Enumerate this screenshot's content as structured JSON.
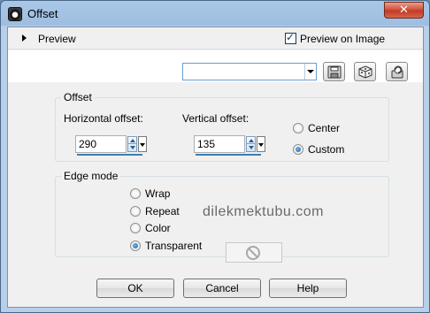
{
  "window": {
    "title": "Offset",
    "close_glyph": "✕"
  },
  "preview": {
    "label": "Preview",
    "preview_on_image_label": "Preview on Image",
    "preview_on_image_checked": true
  },
  "presets": {
    "value": ""
  },
  "toolbar": {
    "icons": [
      "save-preset-icon",
      "randomize-dice-icon",
      "reset-icon"
    ]
  },
  "offset": {
    "group_title": "Offset",
    "horizontal_label": "Horizontal offset:",
    "horizontal_value": "290",
    "vertical_label": "Vertical offset:",
    "vertical_value": "135",
    "center_label": "Center",
    "custom_label": "Custom",
    "selected": "Custom"
  },
  "edge": {
    "group_title": "Edge mode",
    "options": [
      "Wrap",
      "Repeat",
      "Color",
      "Transparent"
    ],
    "selected": "Transparent"
  },
  "watermark": "dilekmektubu.com",
  "buttons": {
    "ok": "OK",
    "cancel": "Cancel",
    "help": "Help"
  },
  "colors": {
    "accent": "#3c7fb1",
    "title_bar": "#a9c7e6",
    "close_red": "#c23a24"
  }
}
